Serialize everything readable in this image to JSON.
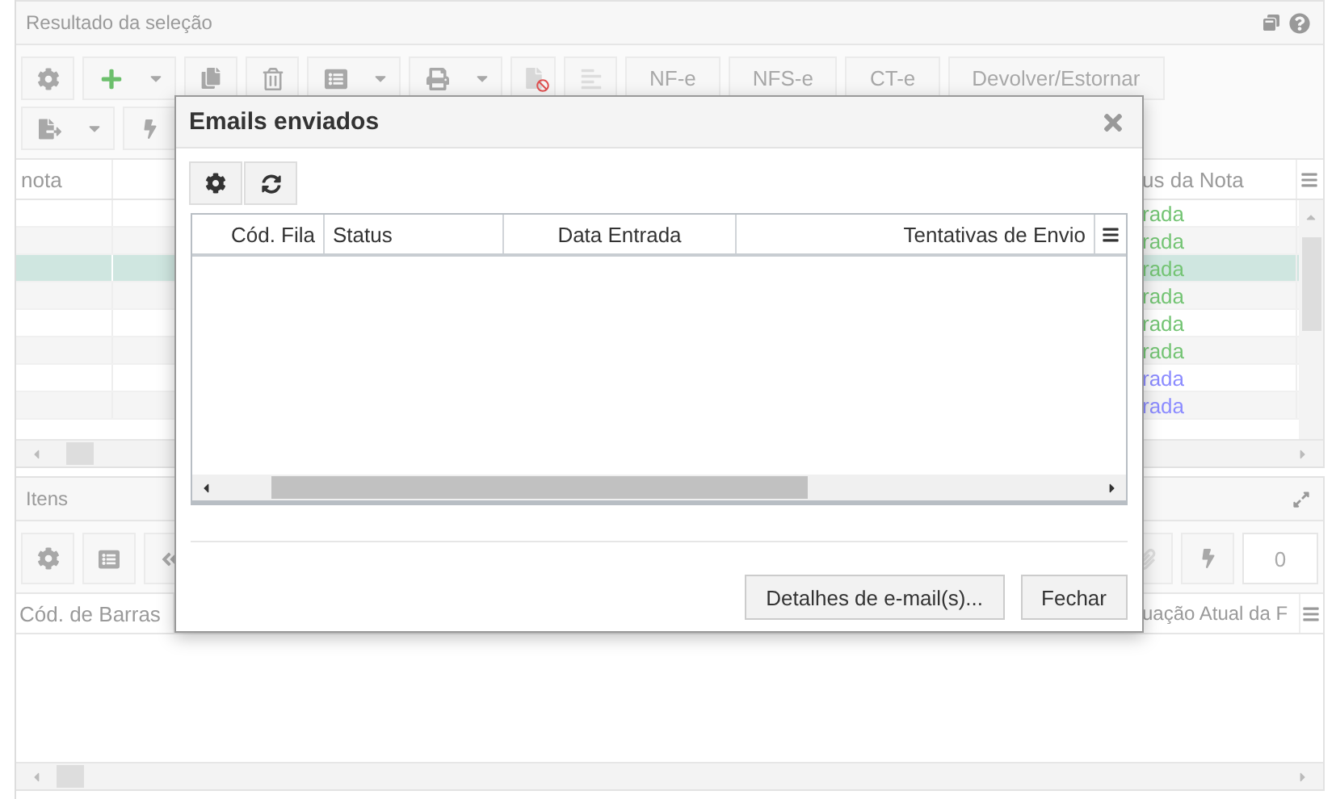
{
  "results_panel": {
    "title": "Resultado da seleção",
    "toolbar_buttons": [
      "NF-e",
      "NFS-e",
      "CT-e",
      "Devolver/Estornar"
    ],
    "columns": [
      "nota",
      "us da Nota"
    ],
    "rows": [
      {
        "status": "rada",
        "color": "#74c474",
        "selected": false
      },
      {
        "status": "rada",
        "color": "#74c474",
        "selected": false
      },
      {
        "status": "rada",
        "color": "#74c474",
        "selected": true
      },
      {
        "status": "rada",
        "color": "#74c474",
        "selected": false
      },
      {
        "status": "rada",
        "color": "#74c474",
        "selected": false
      },
      {
        "status": "rada",
        "color": "#74c474",
        "selected": false
      },
      {
        "status": "rada",
        "color": "#8c8cff",
        "selected": false
      },
      {
        "status": "rada",
        "color": "#8c8cff",
        "selected": false
      }
    ]
  },
  "items_panel": {
    "title": "Itens",
    "columns": [
      "Cód. de Barras",
      "uação Atual da F"
    ],
    "counter": "0"
  },
  "dialog": {
    "title": "Emails enviados",
    "columns": [
      "Cód. Fila",
      "Status",
      "Data Entrada",
      "Tentativas de Envio"
    ],
    "buttons": [
      "Detalhes de e-mail(s)...",
      "Fechar"
    ]
  }
}
